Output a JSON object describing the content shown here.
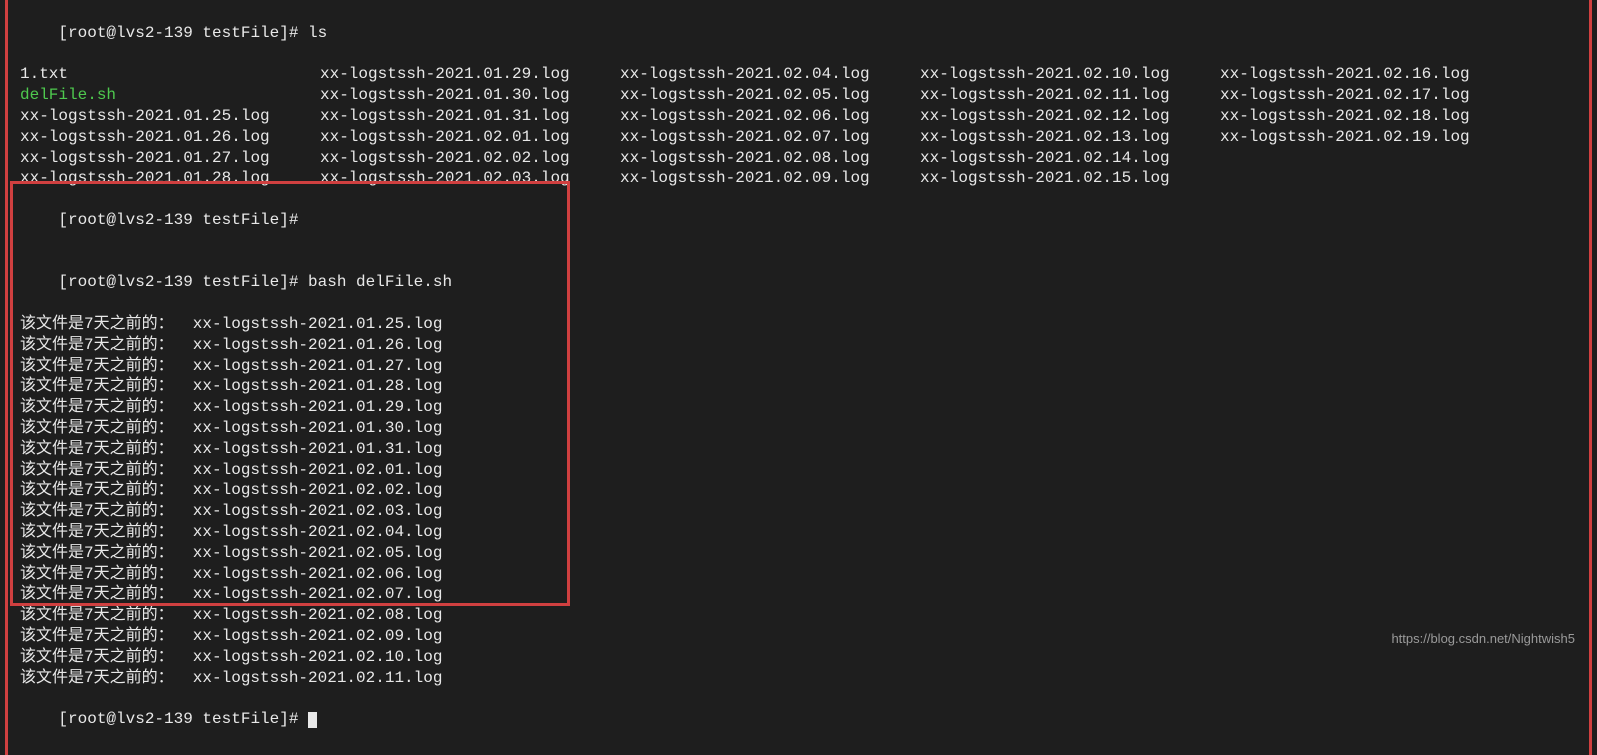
{
  "prompt1_full": "[root@lvs2-139 testFile]# ls",
  "ls": {
    "grid": [
      [
        "1.txt",
        "xx-logstssh-2021.01.29.log",
        "xx-logstssh-2021.02.04.log",
        "xx-logstssh-2021.02.10.log",
        "xx-logstssh-2021.02.16.log"
      ],
      [
        "delFile.sh",
        "xx-logstssh-2021.01.30.log",
        "xx-logstssh-2021.02.05.log",
        "xx-logstssh-2021.02.11.log",
        "xx-logstssh-2021.02.17.log"
      ],
      [
        "xx-logstssh-2021.01.25.log",
        "xx-logstssh-2021.01.31.log",
        "xx-logstssh-2021.02.06.log",
        "xx-logstssh-2021.02.12.log",
        "xx-logstssh-2021.02.18.log"
      ],
      [
        "xx-logstssh-2021.01.26.log",
        "xx-logstssh-2021.02.01.log",
        "xx-logstssh-2021.02.07.log",
        "xx-logstssh-2021.02.13.log",
        "xx-logstssh-2021.02.19.log"
      ],
      [
        "xx-logstssh-2021.01.27.log",
        "xx-logstssh-2021.02.02.log",
        "xx-logstssh-2021.02.08.log",
        "xx-logstssh-2021.02.14.log",
        ""
      ],
      [
        "xx-logstssh-2021.01.28.log",
        "xx-logstssh-2021.02.03.log",
        "xx-logstssh-2021.02.09.log",
        "xx-logstssh-2021.02.15.log",
        ""
      ]
    ],
    "green_file": "delFile.sh"
  },
  "prompt2_full": "[root@lvs2-139 testFile]# ",
  "prompt3_full": "[root@lvs2-139 testFile]# bash delFile.sh",
  "script_output": {
    "prefix": "该文件是7天之前的：  ",
    "files": [
      "xx-logstssh-2021.01.25.log",
      "xx-logstssh-2021.01.26.log",
      "xx-logstssh-2021.01.27.log",
      "xx-logstssh-2021.01.28.log",
      "xx-logstssh-2021.01.29.log",
      "xx-logstssh-2021.01.30.log",
      "xx-logstssh-2021.01.31.log",
      "xx-logstssh-2021.02.01.log",
      "xx-logstssh-2021.02.02.log",
      "xx-logstssh-2021.02.03.log",
      "xx-logstssh-2021.02.04.log",
      "xx-logstssh-2021.02.05.log",
      "xx-logstssh-2021.02.06.log",
      "xx-logstssh-2021.02.07.log",
      "xx-logstssh-2021.02.08.log",
      "xx-logstssh-2021.02.09.log",
      "xx-logstssh-2021.02.10.log",
      "xx-logstssh-2021.02.11.log"
    ]
  },
  "prompt4_full": "[root@lvs2-139 testFile]# ",
  "watermark": "https://blog.csdn.net/Nightwish5"
}
